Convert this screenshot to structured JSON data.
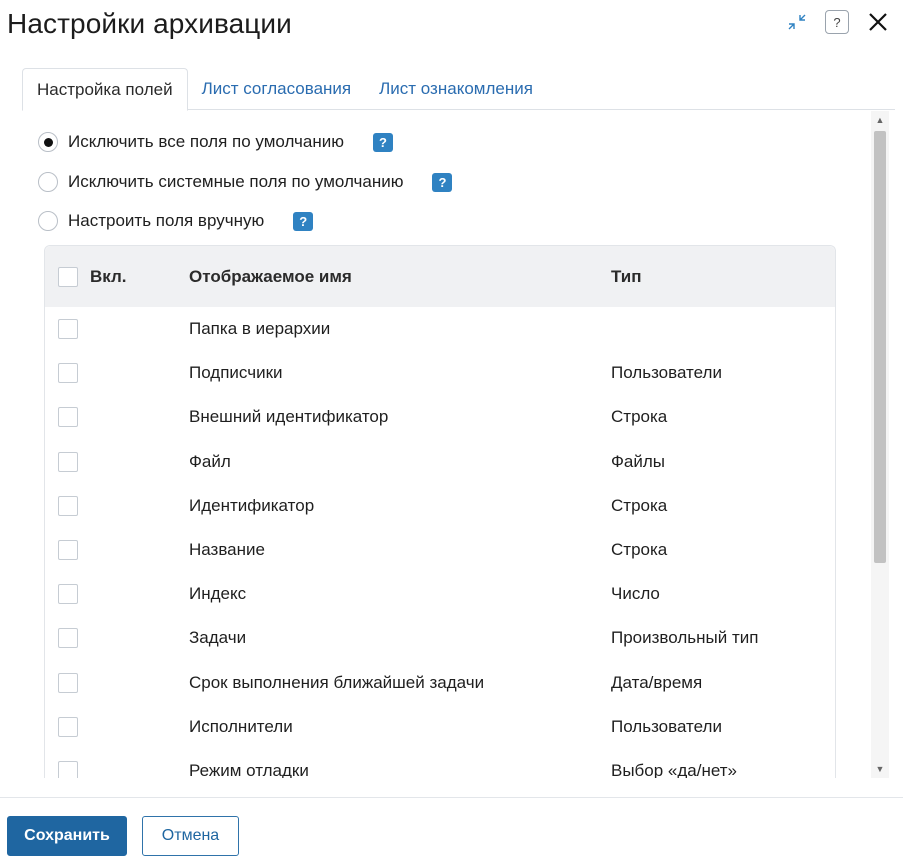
{
  "dialog": {
    "title": "Настройки архивации",
    "help_symbol": "?",
    "colors": {
      "accent": "#1f66a1",
      "link": "#2a6cb0",
      "badge": "#2f82c2"
    }
  },
  "tabs": [
    {
      "label": "Настройка полей",
      "active": true
    },
    {
      "label": "Лист согласования",
      "active": false
    },
    {
      "label": "Лист ознакомления",
      "active": false
    }
  ],
  "options": [
    {
      "label": "Исключить все поля по умолчанию",
      "checked": true,
      "help": "?"
    },
    {
      "label": "Исключить системные поля по умолчанию",
      "checked": false,
      "help": "?"
    },
    {
      "label": "Настроить поля вручную",
      "checked": false,
      "help": "?"
    }
  ],
  "table": {
    "columns": {
      "enabled": "Вкл.",
      "name": "Отображаемое имя",
      "type": "Тип"
    },
    "rows": [
      {
        "name": "Папка в иерархии",
        "type": ""
      },
      {
        "name": "Подписчики",
        "type": "Пользователи"
      },
      {
        "name": "Внешний идентификатор",
        "type": "Строка"
      },
      {
        "name": "Файл",
        "type": "Файлы"
      },
      {
        "name": "Идентификатор",
        "type": "Строка"
      },
      {
        "name": "Название",
        "type": "Строка"
      },
      {
        "name": "Индекс",
        "type": "Число"
      },
      {
        "name": "Задачи",
        "type": "Произвольный тип"
      },
      {
        "name": "Срок выполнения ближайшей задачи",
        "type": "Дата/время"
      },
      {
        "name": "Исполнители",
        "type": "Пользователи"
      },
      {
        "name": "Режим отладки",
        "type": "Выбор «да/нет»"
      }
    ]
  },
  "footer": {
    "save_label": "Сохранить",
    "cancel_label": "Отмена"
  }
}
